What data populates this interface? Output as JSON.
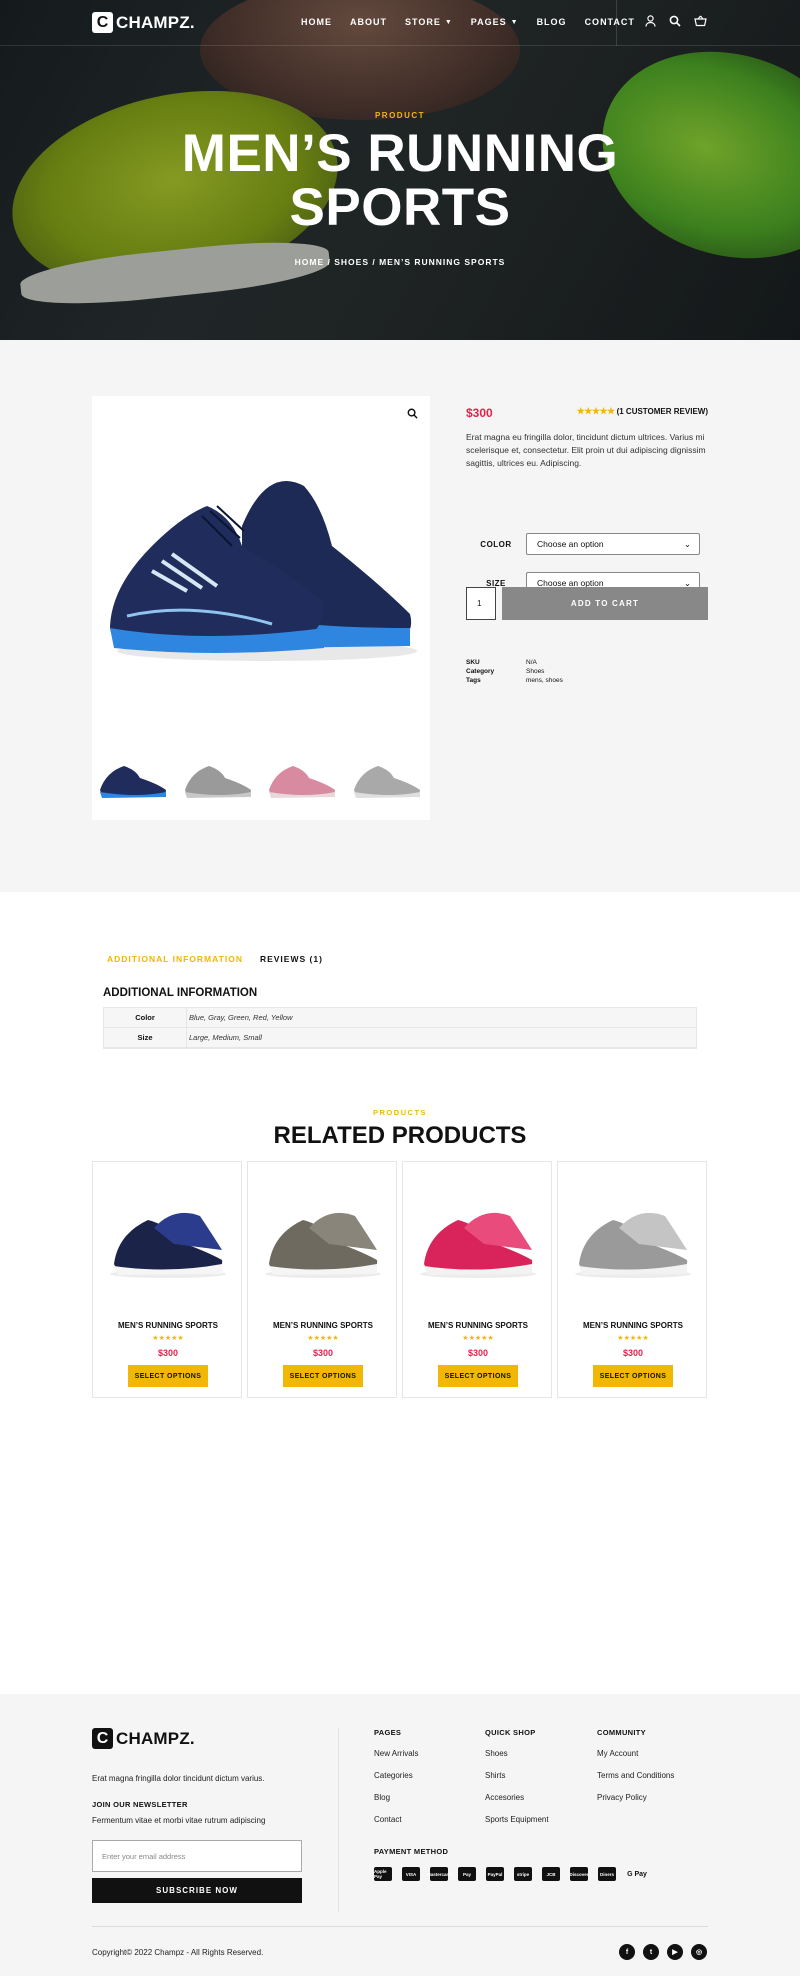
{
  "header": {
    "logo_letter": "C",
    "logo_text": "CHAMPZ.",
    "nav": [
      {
        "label": "HOME"
      },
      {
        "label": "ABOUT"
      },
      {
        "label": "STORE"
      },
      {
        "label": "PAGES"
      },
      {
        "label": "BLOG"
      },
      {
        "label": "CONTACT"
      }
    ],
    "icons": [
      "user-icon",
      "search-icon",
      "cart-icon"
    ]
  },
  "hero": {
    "kicker": "PRODUCT",
    "title_line1": "MEN’S RUNNING",
    "title_line2": "SPORTS",
    "breadcrumb": "HOME / SHOES / MEN’S RUNNING SPORTS"
  },
  "product": {
    "price": "$300",
    "stars": "★★★★★",
    "review_count": "(1 CUSTOMER REVIEW)",
    "description": "Erat magna eu fringilla dolor, tincidunt dictum ultrices. Varius mi scelerisque et, consectetur. Elit proin ut dui adipiscing dignissim sagittis, ultrices eu. Adipiscing.",
    "color_label": "COLOR",
    "color_value": "Choose an option",
    "size_label": "SIZE",
    "size_value": "Choose an option",
    "quantity": "1",
    "add_to_cart": "ADD TO CART",
    "meta": {
      "sku_label": "SKU",
      "sku": "N/A",
      "category_label": "Category",
      "category": "Shoes",
      "tags_label": "Tags",
      "tags": "mens, shoes"
    }
  },
  "tabs": {
    "additional": "ADDITIONAL INFORMATION",
    "reviews": "REVIEWS (1)",
    "section_heading": "ADDITIONAL INFORMATION",
    "rows": [
      {
        "key": "Color",
        "value": "Blue, Gray, Green, Red, Yellow"
      },
      {
        "key": "Size",
        "value": "Large, Medium, Small"
      }
    ]
  },
  "related": {
    "kicker": "PRODUCTS",
    "title": "RELATED PRODUCTS",
    "items": [
      {
        "name": "MEN’S RUNNING SPORTS",
        "stars": "★★★★★",
        "price": "$300",
        "button": "SELECT OPTIONS"
      },
      {
        "name": "MEN’S RUNNING SPORTS",
        "stars": "★★★★★",
        "price": "$300",
        "button": "SELECT OPTIONS"
      },
      {
        "name": "MEN’S RUNNING SPORTS",
        "stars": "★★★★★",
        "price": "$300",
        "button": "SELECT OPTIONS"
      },
      {
        "name": "MEN’S RUNNING SPORTS",
        "stars": "★★★★★",
        "price": "$300",
        "button": "SELECT OPTIONS"
      }
    ]
  },
  "footer": {
    "logo_letter": "C",
    "logo_text": "CHAMPZ.",
    "description": "Erat magna fringilla dolor tincidunt dictum varius.",
    "newsletter_heading": "JOIN OUR NEWSLETTER",
    "newsletter_text": "Fermentum vitae et morbi vitae rutrum adipiscing",
    "email_placeholder": "Enter your email address",
    "subscribe": "SUBSCRIBE NOW",
    "pages": {
      "heading": "PAGES",
      "links": [
        "New Arrivals",
        "Categories",
        "Blog",
        "Contact"
      ]
    },
    "quick_shop": {
      "heading": "QUICK SHOP",
      "links": [
        "Shoes",
        "Shirts",
        "Accesories",
        "Sports Equipment"
      ]
    },
    "community": {
      "heading": "COMMUNITY",
      "links": [
        "My Account",
        "Terms and Conditions",
        "Privacy Policy"
      ]
    },
    "payment_heading": "PAYMENT METHOD",
    "payment_methods": [
      "Apple Pay",
      "VISA",
      "Mastercard",
      "Pay",
      "PayPal",
      "stripe",
      "JCB",
      "Discover",
      "Diners",
      "G Pay"
    ],
    "copyright": "Copyright© 2022 Champz - All Rights Reserved.",
    "social": [
      "facebook-icon",
      "twitter-icon",
      "youtube-icon",
      "instagram-icon"
    ]
  },
  "colors": {
    "accent": "#f2b705",
    "price": "#e8214b",
    "dark": "#111111"
  }
}
